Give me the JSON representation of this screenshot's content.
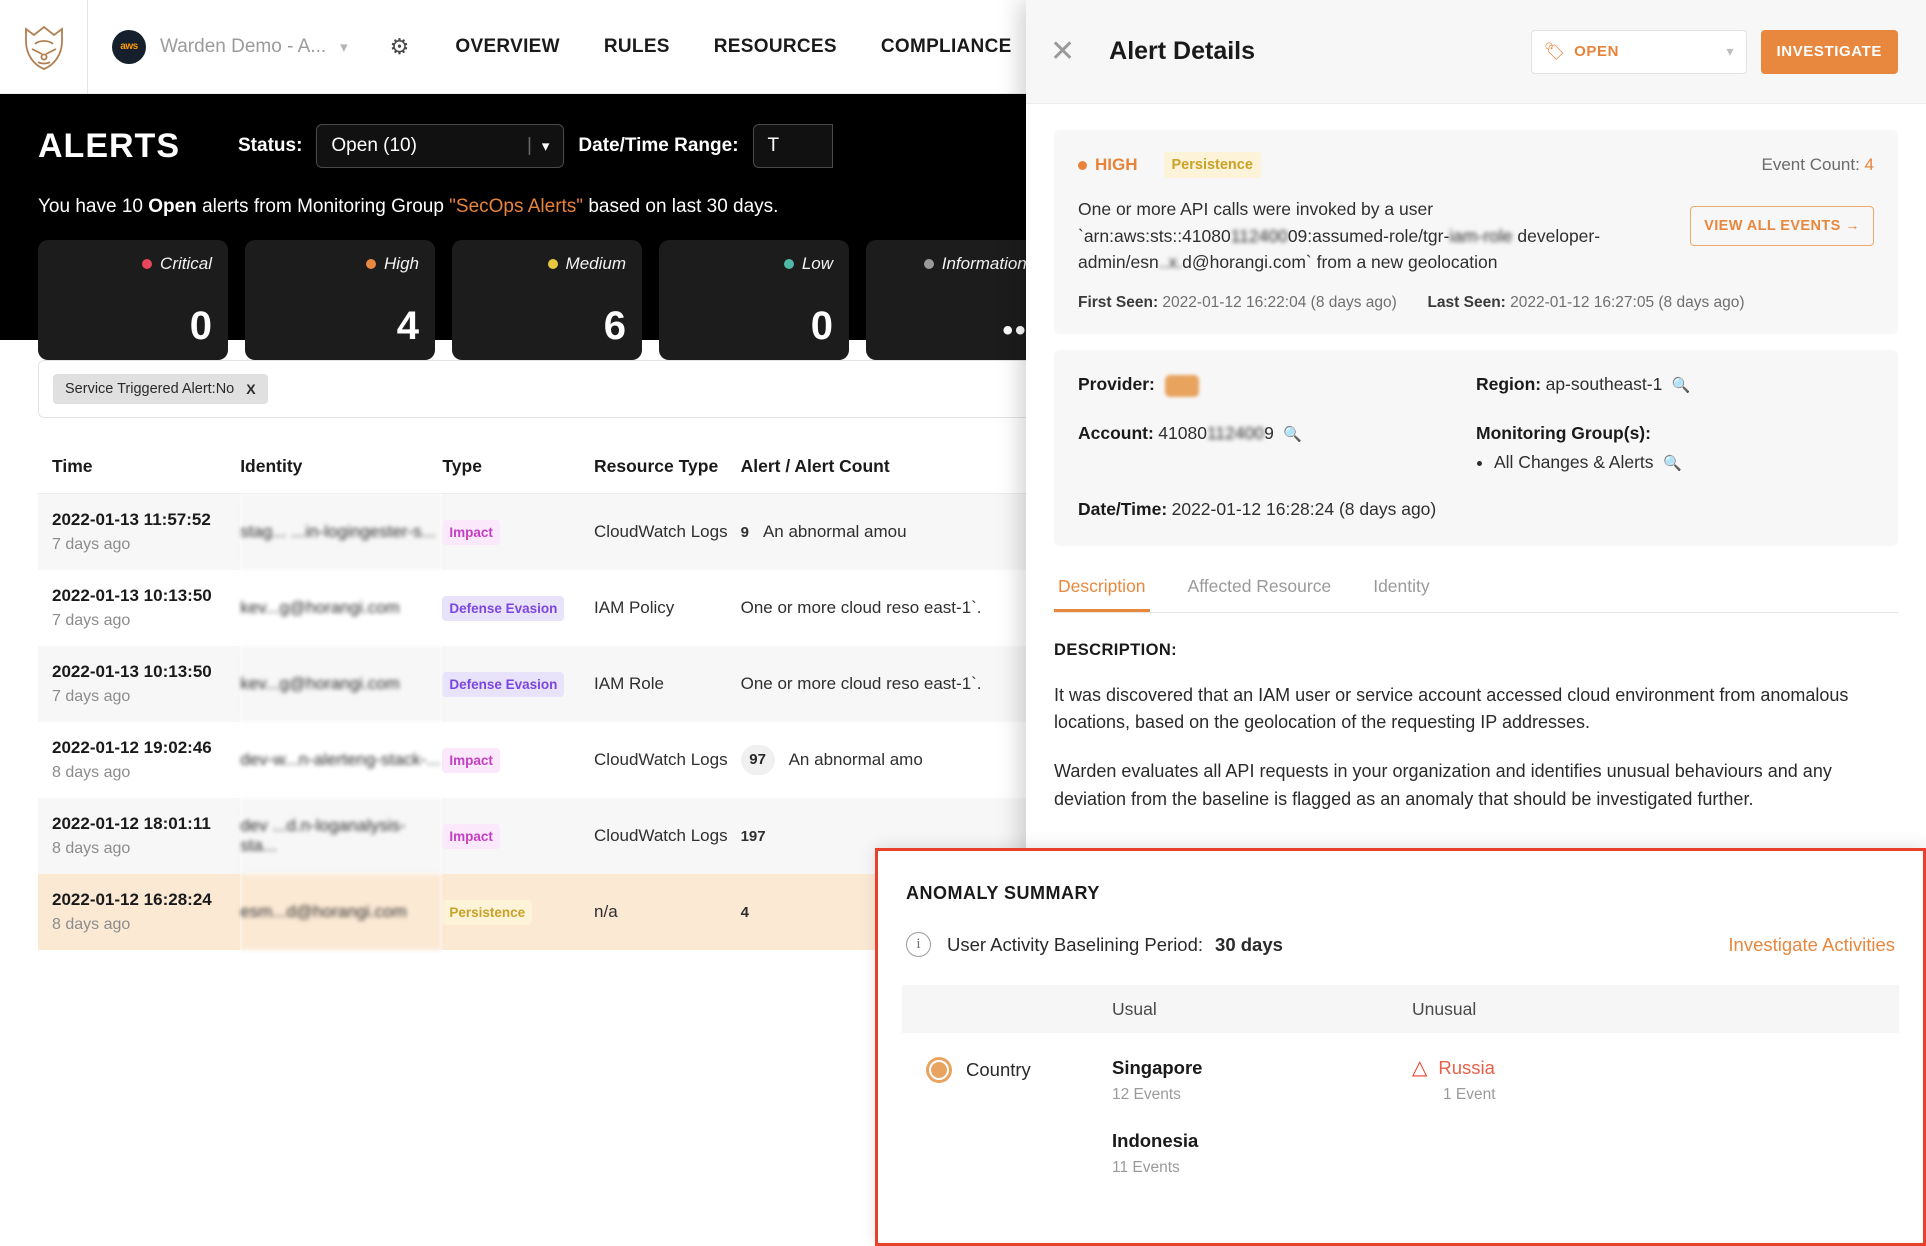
{
  "nav": {
    "logo_icon": "horangi-tiger-logo",
    "org_badge": "aws",
    "org_name": "Warden Demo - A...",
    "settings_icon": "gear-icon",
    "links": [
      "OVERVIEW",
      "RULES",
      "RESOURCES",
      "COMPLIANCE"
    ]
  },
  "hero": {
    "title": "ALERTS",
    "status_label": "Status:",
    "status_value": "Open (10)",
    "daterange_label": "Date/Time Range:",
    "daterange_value": "T",
    "subtitle_pre": "You have 10 ",
    "subtitle_open": "Open",
    "subtitle_mid": " alerts from Monitoring Group ",
    "subtitle_group": "\"SecOps Alerts\"",
    "subtitle_post": " based on last 30 days.",
    "cards": [
      {
        "label": "Critical",
        "value": "0",
        "color": "#e8465a"
      },
      {
        "label": "High",
        "value": "4",
        "color": "#e8883f"
      },
      {
        "label": "Medium",
        "value": "6",
        "color": "#e8c83f"
      },
      {
        "label": "Low",
        "value": "0",
        "color": "#4fb8a8"
      },
      {
        "label": "Informational",
        "value": "•••",
        "color": "#9a9a9a"
      }
    ]
  },
  "filter": {
    "chip_label": "Service Triggered Alert:No",
    "chip_remove": "X"
  },
  "table": {
    "headers": [
      "Time",
      "Identity",
      "Type",
      "Resource Type",
      "Alert / Alert Count"
    ],
    "rows": [
      {
        "time": "2022-01-13 11:57:52",
        "ago": "7 days ago",
        "identity": "stag... ...in-logingester-s...",
        "type": "Impact",
        "type_class": "impact",
        "resource": "CloudWatch Logs",
        "count": "9",
        "count_pill": false,
        "alert": "An abnormal amou"
      },
      {
        "time": "2022-01-13 10:13:50",
        "ago": "7 days ago",
        "identity": "kev...g@horangi.com",
        "type": "Defense Evasion",
        "type_class": "defense",
        "resource": "IAM Policy",
        "count": "",
        "count_pill": false,
        "alert": "One or more cloud reso east-1`."
      },
      {
        "time": "2022-01-13 10:13:50",
        "ago": "7 days ago",
        "identity": "kev...g@horangi.com",
        "type": "Defense Evasion",
        "type_class": "defense",
        "resource": "IAM Role",
        "count": "",
        "count_pill": false,
        "alert": "One or more cloud reso east-1`."
      },
      {
        "time": "2022-01-12 19:02:46",
        "ago": "8 days ago",
        "identity": "dev-w...n-alerteng-stack-...",
        "type": "Impact",
        "type_class": "impact",
        "resource": "CloudWatch Logs",
        "count": "97",
        "count_pill": true,
        "alert": "An abnormal amo"
      },
      {
        "time": "2022-01-12 18:01:11",
        "ago": "8 days ago",
        "identity": "dev ...d.n-loganalysis-sta...",
        "type": "Impact",
        "type_class": "impact",
        "resource": "CloudWatch Logs",
        "count": "197",
        "count_pill": false,
        "alert": ""
      },
      {
        "time": "2022-01-12 16:28:24",
        "ago": "8 days ago",
        "identity": "esm...d@horangi.com",
        "type": "Persistence",
        "type_class": "persistence",
        "resource": "n/a",
        "count": "4",
        "count_pill": false,
        "alert": ""
      }
    ]
  },
  "drawer": {
    "close_icon": "close-icon",
    "title": "Alert Details",
    "status_icon": "tag-icon",
    "status_value": "OPEN",
    "investigate_label": "INVESTIGATE",
    "severity": "HIGH",
    "technique_tag": "Persistence",
    "event_count_label": "Event Count:",
    "event_count_value": "4",
    "summary_line1": "One or more API calls were invoked by a user",
    "summary_arn_pre": "`arn:aws:sts::41080",
    "summary_arn_redacted": "112400",
    "summary_arn_mid": "09:assumed-role/tgr-",
    "summary_arn_redacted2": "iam-role",
    "summary_arn_post": " developer-",
    "summary_line3_pre": "admin/esn",
    "summary_line3_redacted": "..x.",
    "summary_line3_post": "d@horangi.com` from a new geolocation",
    "view_events_label": "VIEW ALL EVENTS →",
    "first_seen_label": "First Seen:",
    "first_seen_value": "2022-01-12 16:22:04 (8 days ago)",
    "last_seen_label": "Last Seen:",
    "last_seen_value": "2022-01-12 16:27:05 (8 days ago)",
    "provider_label": "Provider:",
    "provider_value": "aws",
    "region_label": "Region:",
    "region_value": "ap-southeast-1",
    "account_label": "Account:",
    "account_value": "41080",
    "account_redacted": "112400",
    "account_value_tail": "9",
    "mongroup_label": "Monitoring Group(s):",
    "mongroup_item": "All Changes & Alerts",
    "datetime_label": "Date/Time:",
    "datetime_value": "2022-01-12 16:28:24 (8 days ago)",
    "tabs": [
      {
        "label": "Description",
        "active": true
      },
      {
        "label": "Affected Resource",
        "active": false
      },
      {
        "label": "Identity",
        "active": false
      }
    ],
    "description_heading": "DESCRIPTION:",
    "description_p1": "It was discovered that an IAM user or service account accessed cloud environment from anomalous locations, based on the geolocation of the requesting IP addresses.",
    "description_p2": "Warden evaluates all API requests in your organization and identifies unusual behaviours and any deviation from the baseline is flagged as an anomaly that should be investigated further."
  },
  "anomaly": {
    "title": "ANOMALY SUMMARY",
    "info_icon": "info-icon",
    "baseline_label": "User Activity Baselining Period:",
    "baseline_value": "30 days",
    "link_label": "Investigate Activities",
    "headers": [
      "",
      "Usual",
      "Unusual"
    ],
    "row_icon": "globe-icon",
    "row_label": "Country",
    "usual": [
      {
        "name": "Singapore",
        "sub": "12 Events"
      },
      {
        "name": "Indonesia",
        "sub": "11 Events"
      }
    ],
    "unusual": [
      {
        "name": "Russia",
        "sub": "1 Event",
        "warn_icon": "warning-triangle-icon"
      }
    ],
    "border_color": "#e8402a"
  }
}
